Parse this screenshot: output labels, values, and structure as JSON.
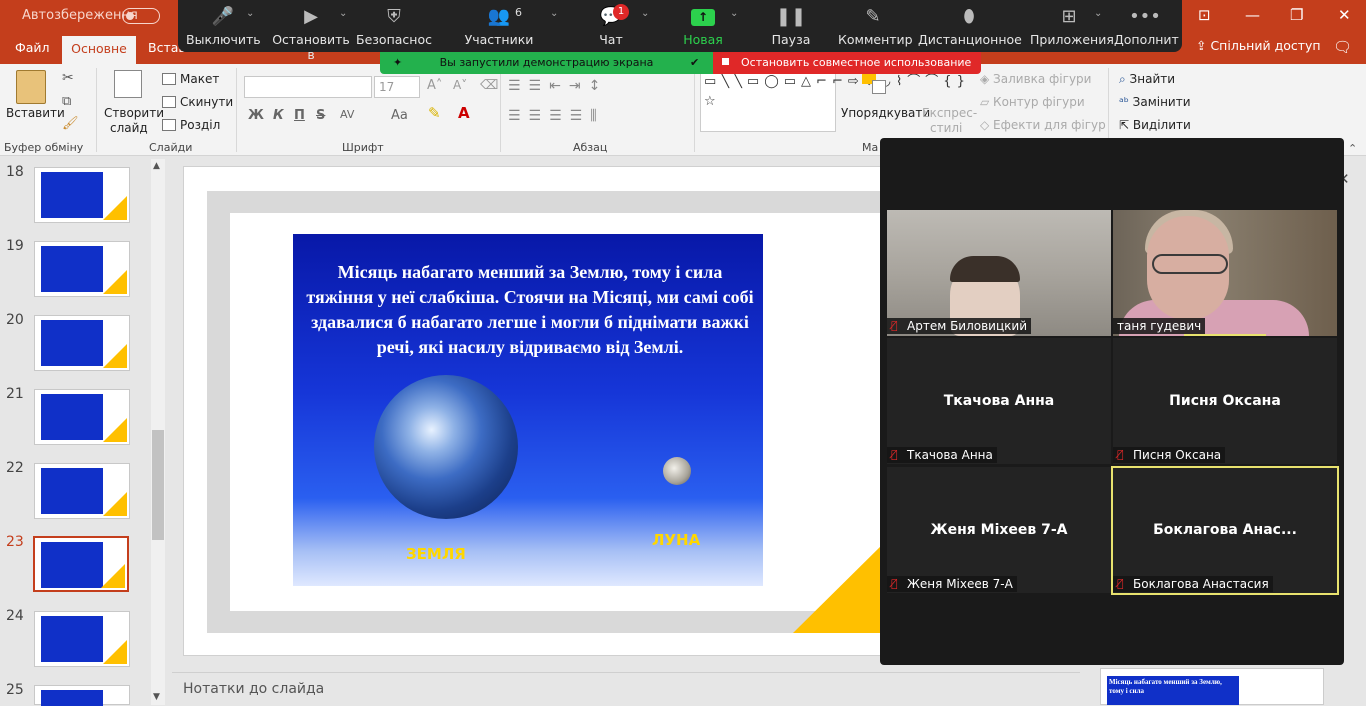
{
  "titlebar": {
    "autosave_label": "Автозбереження",
    "window_controls": [
      "⊡",
      "—",
      "❐",
      "✕"
    ]
  },
  "ribbon_tabs": {
    "file": "Файл",
    "home": "Основне",
    "insert": "Вставлення",
    "share": "Спільний доступ"
  },
  "ribbon": {
    "clipboard": {
      "paste": "Вставити",
      "group": "Буфер обміну"
    },
    "slides": {
      "new_slide_line1": "Створити",
      "new_slide_line2": "слайд",
      "layout": "Макет",
      "reset": "Скинути",
      "section": "Розділ",
      "group": "Слайди"
    },
    "font": {
      "size": "17",
      "group": "Шрифт",
      "bold": "Ж",
      "italic": "К",
      "underline": "П",
      "strike": "S",
      "spacing": "AV",
      "case": "Aa"
    },
    "paragraph": {
      "group": "Абзац"
    },
    "drawing": {
      "arrange": "Упорядкувати",
      "quick_styles_line1": "Експрес-",
      "quick_styles_line2": "стилі",
      "fill": "Заливка фігури",
      "outline": "Контур фігури",
      "effects": "Ефекти для фігур",
      "group": "Ма"
    },
    "editing": {
      "find": "Знайти",
      "replace": "Замінити",
      "select": "Виділити"
    }
  },
  "zoom_toolbar": {
    "mute": "Выключить",
    "stop_video": "Остановить в",
    "security": "Безопаснос",
    "participants": "Участники",
    "participants_count": "6",
    "chat": "Чат",
    "chat_badge": "1",
    "new_demo": "Новая демон",
    "pause_demo": "Пауза демон",
    "annotate": "Комментир",
    "remote_control": "Дистанционное у",
    "apps": "Приложения",
    "more": "Дополнит"
  },
  "share_banner": {
    "message": "Вы запустили демонстрацию экрана",
    "stop": "Остановить совместное использование"
  },
  "thumbnails": {
    "numbers": [
      "18",
      "19",
      "20",
      "21",
      "22",
      "23",
      "24",
      "25"
    ],
    "selected": "23"
  },
  "slide": {
    "text": "Місяць набагато менший за Землю, тому і сила тяжіння у неї слабкіша. Стоячи на Місяці, ми самі собі здавалися б набагато легше і могли б піднімати важкі речі, які насилу відриваємо від Землі.",
    "label_earth": "ЗЕМЛЯ",
    "label_moon": "ЛУНА"
  },
  "notes_placeholder": "Нотатки до слайда",
  "mini_slide_text": "Місяць набагато менший за Землю, тому і сила",
  "gallery": {
    "participants": [
      {
        "tag": "Артем Биловицкий",
        "video": true
      },
      {
        "tag": "таня гудевич",
        "video": true
      },
      {
        "name": "Ткачова Анна",
        "tag": "Ткачова Анна"
      },
      {
        "name": "Писня Оксана",
        "tag": "Писня Оксана"
      },
      {
        "name": "Женя Міхеев 7-А",
        "tag": "Женя Міхеев 7-А"
      },
      {
        "name": "Боклагова  Анас...",
        "tag": "Боклагова Анастасия"
      }
    ]
  },
  "colors": {
    "office_accent": "#c43e1c",
    "zoom_green": "#23b14d",
    "zoom_red": "#e02828",
    "slide_yellow": "#ffc000"
  }
}
